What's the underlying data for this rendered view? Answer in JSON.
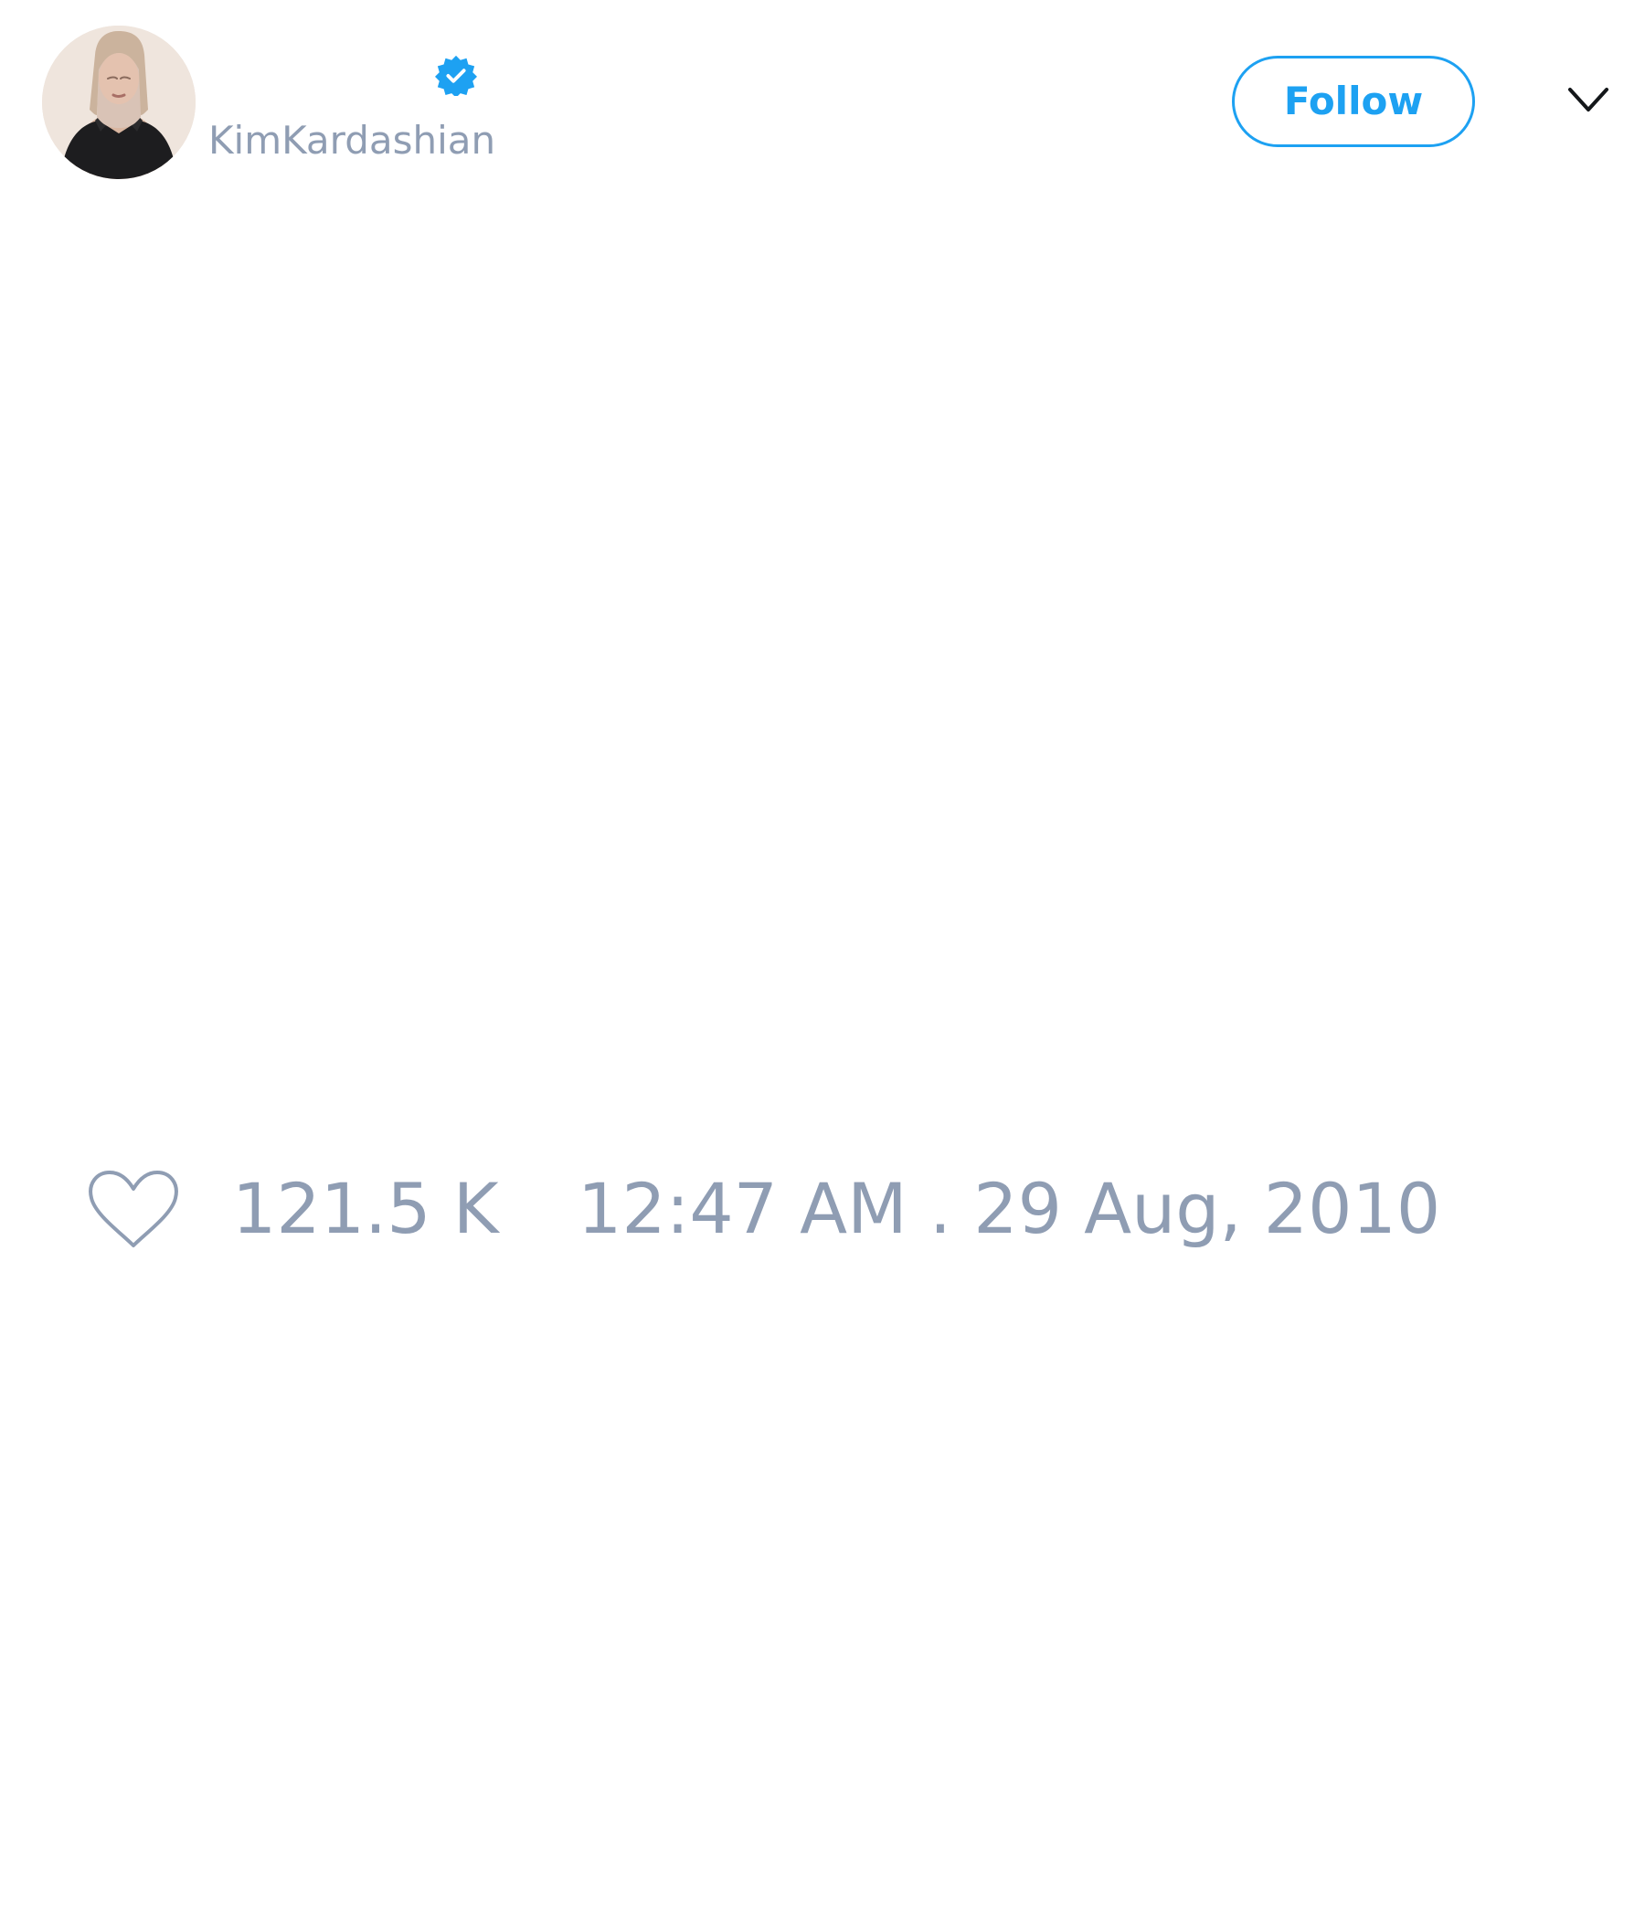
{
  "tweet": {
    "author": {
      "display_name": "",
      "handle": "KimKardashian",
      "verified": true,
      "avatar": "profile-photo"
    },
    "follow_label": "Follow",
    "menu_icon": "chevron-down-icon",
    "like_icon": "heart-icon",
    "like_count": "121.5 K",
    "timestamp": "12:47 AM . 29 Aug, 2010"
  },
  "colors": {
    "accent": "#1da1f2",
    "muted_text": "#8f9db3",
    "background": "#ffffff",
    "icon_dark": "#14171a"
  }
}
